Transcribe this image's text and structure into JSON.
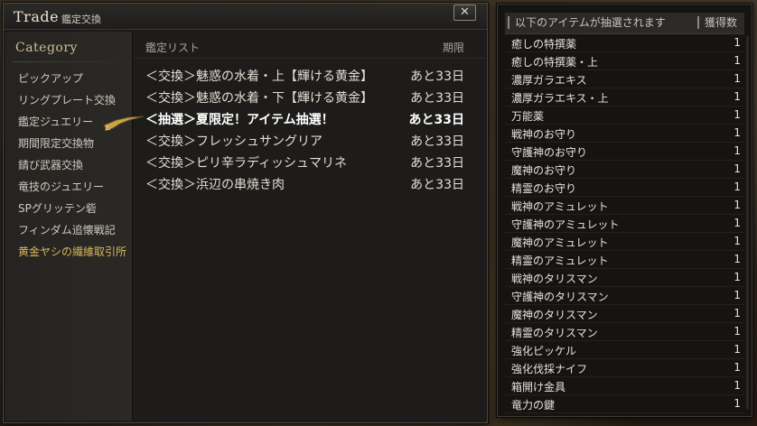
{
  "window": {
    "title": "Trade",
    "subtitle": "鑑定交換",
    "close_label": "✕"
  },
  "category": {
    "header": "Category",
    "items": [
      {
        "label": "ピックアップ",
        "active": false
      },
      {
        "label": "リングプレート交換",
        "active": false
      },
      {
        "label": "鑑定ジュエリー",
        "active": false
      },
      {
        "label": "期間限定交換物",
        "active": false
      },
      {
        "label": "錆び武器交換",
        "active": false
      },
      {
        "label": "竜技のジュエリー",
        "active": false
      },
      {
        "label": "SPグリッテン砦",
        "active": false
      },
      {
        "label": "フィンダム追懐戦記",
        "active": false
      },
      {
        "label": "黄金ヤシの繊維取引所",
        "active": true
      }
    ]
  },
  "list": {
    "header_left": "鑑定リスト",
    "header_right": "期限",
    "rows": [
      {
        "name": "＜交換＞魅惑の水着・上【輝ける黄金】",
        "expiry": "あと33日",
        "selected": false
      },
      {
        "name": "＜交換＞魅惑の水着・下【輝ける黄金】",
        "expiry": "あと33日",
        "selected": false
      },
      {
        "name": "＜抽選＞夏限定！アイテム抽選！",
        "expiry": "あと33日",
        "selected": true
      },
      {
        "name": "＜交換＞フレッシュサングリア",
        "expiry": "あと33日",
        "selected": false
      },
      {
        "name": "＜交換＞ピリ辛ラディッシュマリネ",
        "expiry": "あと33日",
        "selected": false
      },
      {
        "name": "＜交換＞浜辺の串焼き肉",
        "expiry": "あと33日",
        "selected": false
      }
    ]
  },
  "lottery": {
    "header_left": "以下のアイテムが抽選されます",
    "header_right": "獲得数",
    "items": [
      {
        "name": "癒しの特撰薬",
        "count": "1"
      },
      {
        "name": "癒しの特撰薬・上",
        "count": "1"
      },
      {
        "name": "濃厚ガラエキス",
        "count": "1"
      },
      {
        "name": "濃厚ガラエキス・上",
        "count": "1"
      },
      {
        "name": "万能薬",
        "count": "1"
      },
      {
        "name": "戦神のお守り",
        "count": "1"
      },
      {
        "name": "守護神のお守り",
        "count": "1"
      },
      {
        "name": "魔神のお守り",
        "count": "1"
      },
      {
        "name": "精霊のお守り",
        "count": "1"
      },
      {
        "name": "戦神のアミュレット",
        "count": "1"
      },
      {
        "name": "守護神のアミュレット",
        "count": "1"
      },
      {
        "name": "魔神のアミュレット",
        "count": "1"
      },
      {
        "name": "精霊のアミュレット",
        "count": "1"
      },
      {
        "name": "戦神のタリスマン",
        "count": "1"
      },
      {
        "name": "守護神のタリスマン",
        "count": "1"
      },
      {
        "name": "魔神のタリスマン",
        "count": "1"
      },
      {
        "name": "精霊のタリスマン",
        "count": "1"
      },
      {
        "name": "強化ピッケル",
        "count": "1"
      },
      {
        "name": "強化伐採ナイフ",
        "count": "1"
      },
      {
        "name": "箱開け金具",
        "count": "1"
      },
      {
        "name": "竜力の鍵",
        "count": "1"
      }
    ]
  },
  "colors": {
    "active_category": "#d9b65c",
    "pointer_gold": "#c8a54a"
  }
}
